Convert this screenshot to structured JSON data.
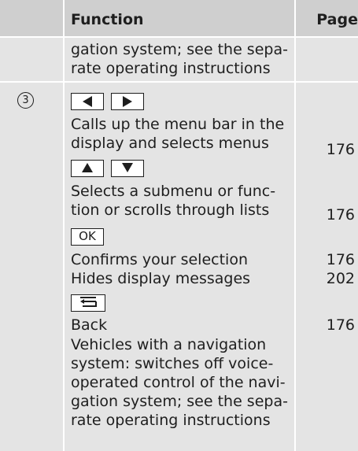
{
  "header": {
    "function_label": "Function",
    "page_label": "Page"
  },
  "row1": {
    "lines": [
      "gation system; see the sepa-",
      "rate operating instructions"
    ]
  },
  "row2": {
    "number": "3",
    "keys": {
      "left_right": [
        "left-arrow-key",
        "right-arrow-key"
      ],
      "up_down": [
        "up-arrow-key",
        "down-arrow-key"
      ],
      "ok": "OK",
      "back": "back-key"
    },
    "entries": [
      {
        "lines": [
          "Calls up the menu bar in the",
          "display and selects menus"
        ],
        "page": "176"
      },
      {
        "lines": [
          "Selects a submenu or func-",
          "tion or scrolls through lists"
        ],
        "page": "176"
      },
      {
        "lines": [
          "Confirms your selection"
        ],
        "page": "176"
      },
      {
        "lines": [
          "Hides display messages"
        ],
        "page": "202"
      },
      {
        "lines": [
          "Back"
        ],
        "page": "176"
      },
      {
        "lines": [
          "Vehicles with a navigation",
          "system: switches off voice-",
          "operated control of the navi-",
          "gation system; see the sepa-",
          "rate operating instructions"
        ],
        "page": ""
      }
    ]
  }
}
